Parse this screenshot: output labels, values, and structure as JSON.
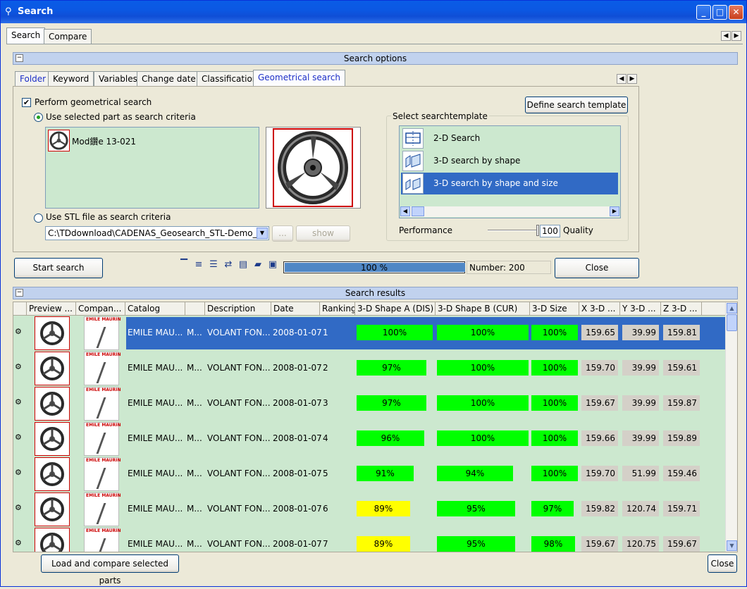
{
  "window": {
    "title": "Search",
    "minimize": "_",
    "maximize": "□",
    "close": "✕"
  },
  "top_tabs": [
    {
      "label": "Search"
    },
    {
      "label": "Compare"
    }
  ],
  "search_options": {
    "header": "Search options"
  },
  "option_tabs": [
    {
      "label": "Folder"
    },
    {
      "label": "Keyword"
    },
    {
      "label": "Variables"
    },
    {
      "label": "Change date"
    },
    {
      "label": "Classification"
    },
    {
      "label": "Geometrical search"
    }
  ],
  "geo": {
    "perform_label": "Perform geometrical search",
    "use_selected_label": "Use selected part as search criteria",
    "part_name": "Mod鑽e 13-021",
    "use_stl_label": "Use STL file as search criteria",
    "stl_path": "C:\\TDdownload\\CADENAS_Geosearch_STL-Demo_Libr",
    "browse_label": "...",
    "show_label": "show",
    "define_template_label": "Define search template",
    "select_template_label": "Select searchtemplate",
    "templates": [
      {
        "label": "2-D Search"
      },
      {
        "label": "3-D search by shape"
      },
      {
        "label": "3-D search by shape and size"
      }
    ],
    "performance_label": "Performance",
    "quality_value": "100",
    "quality_label": "Quality"
  },
  "toolbar": {
    "start_search_label": "Start search",
    "progress_text": "100 %",
    "progress_value": 1.0,
    "number_text": "Number: 200",
    "close_label": "Close"
  },
  "results": {
    "header": "Search results",
    "columns": [
      "",
      "Preview ...",
      "Compan...",
      "Catalog",
      "",
      "Description",
      "Date",
      "Ranking",
      "3-D Shape A (DIS)",
      "3-D Shape B (CUR)",
      "3-D Size",
      "X 3-D ...",
      "Y 3-D ...",
      "Z 3-D ..."
    ],
    "rows": [
      {
        "catalog": "EMILE MAU...",
        "m": "M...",
        "description": "VOLANT FON...",
        "date": "2008-01-07",
        "rank": "1",
        "shape_a": "100%",
        "shape_a_v": 1.0,
        "shape_a_c": "g",
        "shape_b": "100%",
        "shape_b_v": 1.0,
        "size": "100%",
        "size_v": 1.0,
        "x": "159.65",
        "y": "39.99",
        "z": "159.81"
      },
      {
        "catalog": "EMILE MAU...",
        "m": "M...",
        "description": "VOLANT FON...",
        "date": "2008-01-07",
        "rank": "2",
        "shape_a": "97%",
        "shape_a_v": 0.97,
        "shape_a_c": "g",
        "shape_b": "100%",
        "shape_b_v": 1.0,
        "size": "100%",
        "size_v": 1.0,
        "x": "159.70",
        "y": "39.99",
        "z": "159.61"
      },
      {
        "catalog": "EMILE MAU...",
        "m": "M...",
        "description": "VOLANT FON...",
        "date": "2008-01-07",
        "rank": "3",
        "shape_a": "97%",
        "shape_a_v": 0.97,
        "shape_a_c": "g",
        "shape_b": "100%",
        "shape_b_v": 1.0,
        "size": "100%",
        "size_v": 1.0,
        "x": "159.67",
        "y": "39.99",
        "z": "159.87"
      },
      {
        "catalog": "EMILE MAU...",
        "m": "M...",
        "description": "VOLANT FON...",
        "date": "2008-01-07",
        "rank": "4",
        "shape_a": "96%",
        "shape_a_v": 0.96,
        "shape_a_c": "g",
        "shape_b": "100%",
        "shape_b_v": 1.0,
        "size": "100%",
        "size_v": 1.0,
        "x": "159.66",
        "y": "39.99",
        "z": "159.89"
      },
      {
        "catalog": "EMILE MAU...",
        "m": "M...",
        "description": "VOLANT FON...",
        "date": "2008-01-07",
        "rank": "5",
        "shape_a": "91%",
        "shape_a_v": 0.91,
        "shape_a_c": "g",
        "shape_b": "94%",
        "shape_b_v": 0.94,
        "size": "100%",
        "size_v": 1.0,
        "x": "159.70",
        "y": "51.99",
        "z": "159.46"
      },
      {
        "catalog": "EMILE MAU...",
        "m": "M...",
        "description": "VOLANT FON...",
        "date": "2008-01-07",
        "rank": "6",
        "shape_a": "89%",
        "shape_a_v": 0.89,
        "shape_a_c": "y",
        "shape_b": "95%",
        "shape_b_v": 0.95,
        "size": "97%",
        "size_v": 0.97,
        "x": "159.82",
        "y": "120.74",
        "z": "159.71"
      },
      {
        "catalog": "EMILE MAU...",
        "m": "M...",
        "description": "VOLANT FON...",
        "date": "2008-01-07",
        "rank": "7",
        "shape_a": "89%",
        "shape_a_v": 0.89,
        "shape_a_c": "y",
        "shape_b": "95%",
        "shape_b_v": 0.95,
        "size": "98%",
        "size_v": 0.98,
        "x": "159.67",
        "y": "120.75",
        "z": "159.67"
      }
    ],
    "company_logo_text": "EMILE MAURIN"
  },
  "footer": {
    "load_compare_label": "Load and compare selected parts",
    "close_label": "Close"
  }
}
